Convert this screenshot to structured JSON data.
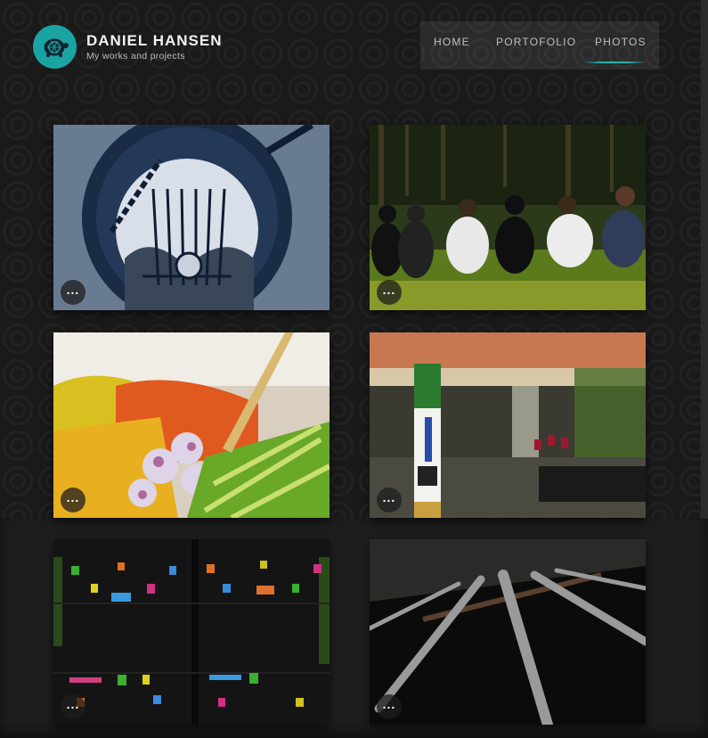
{
  "brand": {
    "name": "DANIEL HANSEN",
    "tagline": "My works and projects",
    "logo_icon": "turtle-icon",
    "accent": "#1aa3a3"
  },
  "nav": {
    "items": [
      {
        "label": "HOME"
      },
      {
        "label": "PORTOFOLIO"
      },
      {
        "label": "PHOTOS",
        "active": true
      }
    ]
  },
  "gallery": {
    "more_label": "...",
    "photos": [
      {
        "subject": "manhole-reflection"
      },
      {
        "subject": "people-sitting-on-grass"
      },
      {
        "subject": "salad-vegetables"
      },
      {
        "subject": "post-with-qr-code"
      },
      {
        "subject": "wall-with-flower-pots"
      },
      {
        "subject": "metal-grate"
      }
    ]
  }
}
